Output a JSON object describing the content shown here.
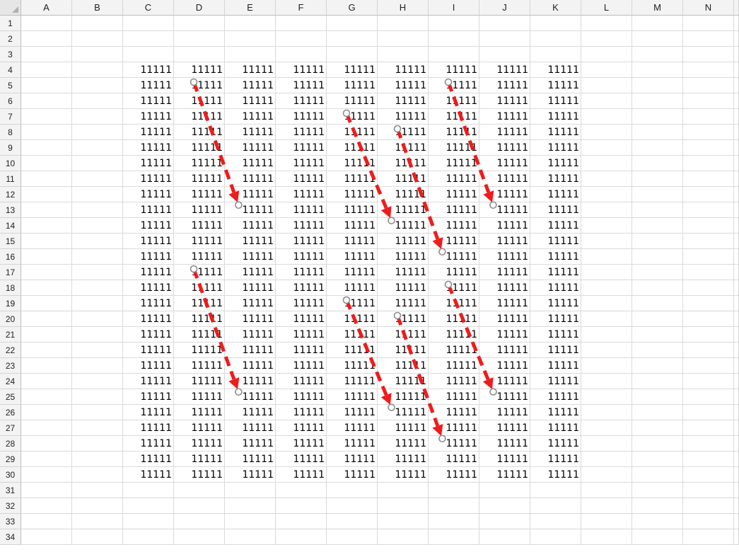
{
  "columns": [
    "A",
    "B",
    "C",
    "D",
    "E",
    "F",
    "G",
    "H",
    "I",
    "J",
    "K",
    "L",
    "M",
    "N"
  ],
  "rows": [
    "1",
    "2",
    "3",
    "4",
    "5",
    "6",
    "7",
    "8",
    "9",
    "10",
    "11",
    "12",
    "13",
    "14",
    "15",
    "16",
    "17",
    "18",
    "19",
    "20",
    "21",
    "22",
    "23",
    "24",
    "25",
    "26",
    "27",
    "28",
    "29",
    "30",
    "31",
    "32",
    "33",
    "34"
  ],
  "cell_value": "11111",
  "filled_range": {
    "from_col": "C",
    "to_col": "K",
    "from_row": "4",
    "to_row": "30"
  },
  "arrow_style": {
    "color": "#ee1c1c",
    "endpoint_color": "#8c8c8c",
    "line": "dashed"
  },
  "arrows": [
    {
      "from": "D5",
      "to": "E13"
    },
    {
      "from": "G7",
      "to": "H14"
    },
    {
      "from": "H8",
      "to": "I16"
    },
    {
      "from": "I5",
      "to": "J13"
    },
    {
      "from": "D17",
      "to": "E25"
    },
    {
      "from": "G19",
      "to": "H26"
    },
    {
      "from": "H20",
      "to": "I28"
    },
    {
      "from": "I18",
      "to": "J25"
    }
  ]
}
